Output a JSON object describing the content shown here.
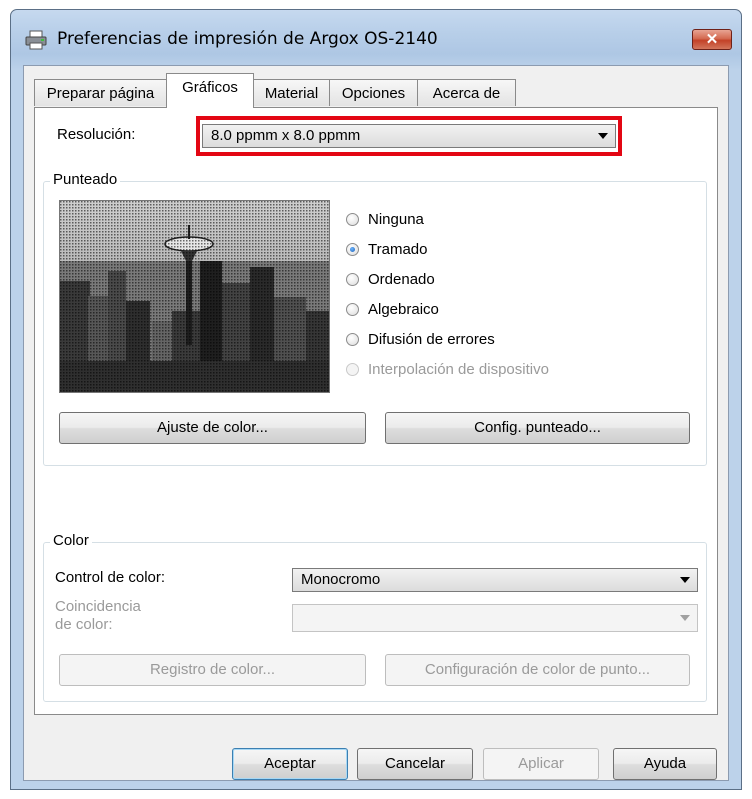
{
  "window": {
    "title": "Preferencias de impresión de Argox OS-2140",
    "close_label": "✕"
  },
  "tabs": [
    {
      "label": "Preparar página"
    },
    {
      "label": "Gráficos"
    },
    {
      "label": "Material"
    },
    {
      "label": "Opciones"
    },
    {
      "label": "Acerca de"
    }
  ],
  "active_tab": "Gráficos",
  "resolution": {
    "label": "Resolución:",
    "value": "8.0 ppmm x 8.0 ppmm"
  },
  "dithering": {
    "group_title": "Punteado",
    "options": [
      {
        "label": "Ninguna",
        "checked": false,
        "enabled": true
      },
      {
        "label": "Tramado",
        "checked": true,
        "enabled": true
      },
      {
        "label": "Ordenado",
        "checked": false,
        "enabled": true
      },
      {
        "label": "Algebraico",
        "checked": false,
        "enabled": true
      },
      {
        "label": "Difusión de errores",
        "checked": false,
        "enabled": true
      },
      {
        "label": "Interpolación de dispositivo",
        "checked": false,
        "enabled": false
      }
    ],
    "color_adjust_button": "Ajuste de color...",
    "dither_config_button": "Config. punteado..."
  },
  "color": {
    "group_title": "Color",
    "control_label": "Control de color:",
    "control_value": "Monocromo",
    "matching_label_line1": "Coincidencia",
    "matching_label_line2": "de color:",
    "matching_value": "",
    "register_button": "Registro de color...",
    "spot_config_button": "Configuración de color de punto..."
  },
  "footer": {
    "ok": "Aceptar",
    "cancel": "Cancelar",
    "apply": "Aplicar",
    "help": "Ayuda"
  },
  "colors": {
    "highlight": "#e30613",
    "close_button": "#c34127"
  },
  "icons": {
    "title": "printer-icon",
    "close": "close-icon",
    "dropdown": "chevron-down-icon"
  }
}
